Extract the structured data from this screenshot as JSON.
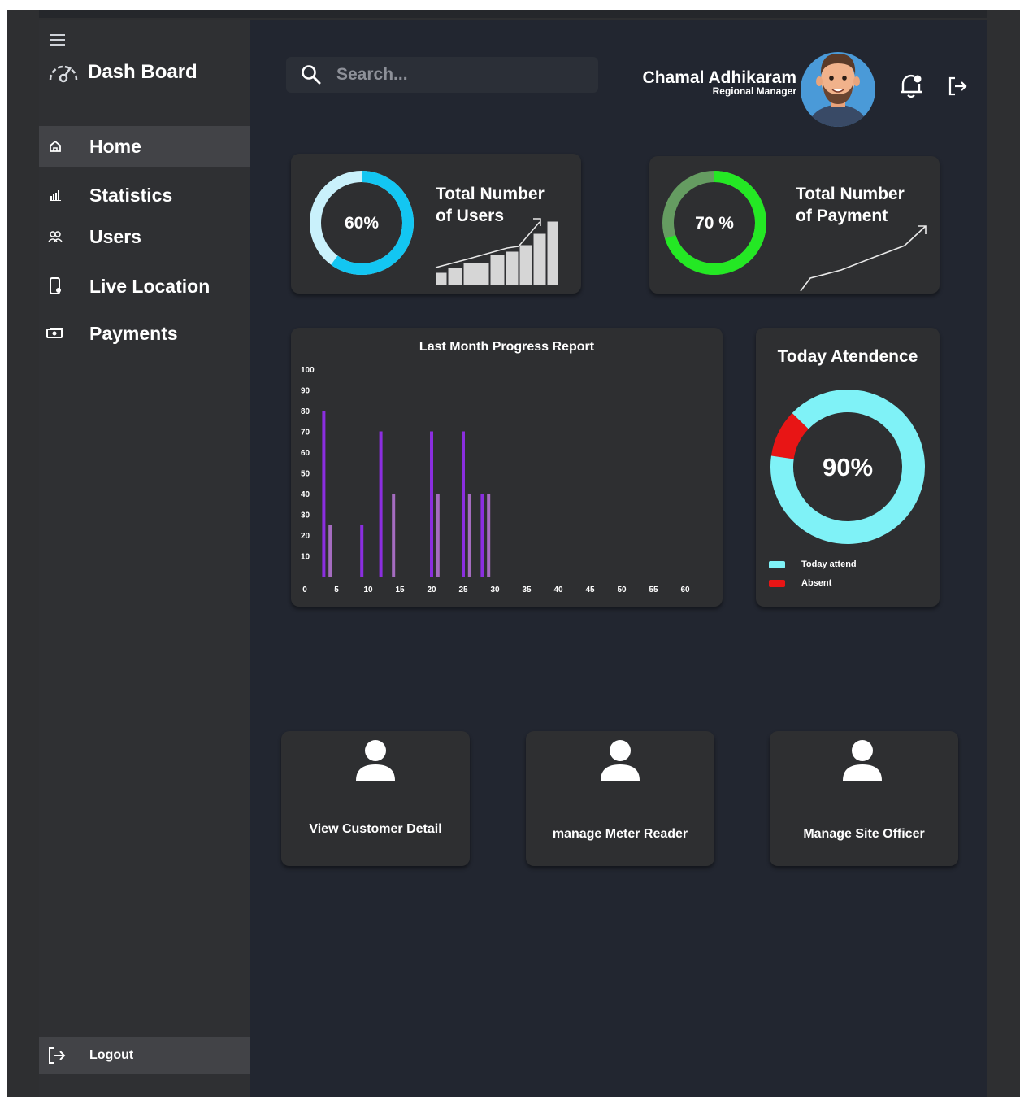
{
  "colors": {
    "main_bg": "#222630",
    "sidebar_bg": "#2f3033",
    "card_bg": "#2e2f31",
    "users_ring": "#13c6f2",
    "payment_ring": "#24e824",
    "bar_primary": "#8b2ee0",
    "bar_secondary": "#a56cc0",
    "attend": "#7ff2f7",
    "absent": "#e81515"
  },
  "sidebar": {
    "menu_icon": "hamburger-icon",
    "brand_icon": "speedometer-icon",
    "brand_title": "Dash Board",
    "items": [
      {
        "label": "Home",
        "icon": "home-icon"
      },
      {
        "label": "Statistics",
        "icon": "bar-chart-icon"
      },
      {
        "label": "Users",
        "icon": "users-icon"
      },
      {
        "label": "Live Location",
        "icon": "location-phone-icon"
      },
      {
        "label": "Payments",
        "icon": "payments-icon"
      }
    ],
    "logout": {
      "label": "Logout",
      "icon": "logout-icon"
    }
  },
  "header": {
    "search_placeholder": "Search...",
    "user_name": "Chamal Adhikaram",
    "user_role": "Regional Manager",
    "avatar_icon": "avatar",
    "notification_icon": "bell-icon",
    "exit_icon": "exit-icon"
  },
  "stats": {
    "users": {
      "percent": 60,
      "label": "60%",
      "title_line1": "Total Number",
      "title_line2": "of Users"
    },
    "payment": {
      "percent": 70,
      "label": "70 %",
      "title_line1": "Total Number",
      "title_line2": "of Payment"
    }
  },
  "chart_data": {
    "type": "bar",
    "title": "Last Month Progress Report",
    "xlabel": "",
    "ylabel": "",
    "x_ticks": [
      0,
      5,
      10,
      15,
      20,
      25,
      30,
      35,
      40,
      45,
      50,
      55,
      60
    ],
    "y_ticks": [
      10,
      20,
      30,
      40,
      50,
      60,
      70,
      80,
      90,
      100
    ],
    "xlim": [
      0,
      60
    ],
    "ylim": [
      0,
      100
    ],
    "grid": false,
    "series": [
      {
        "x": [
          3,
          9,
          12,
          20,
          25,
          28
        ],
        "values": [
          80,
          25,
          70,
          70,
          70,
          40
        ]
      },
      {
        "x": [
          4,
          14,
          21,
          26,
          29
        ],
        "values": [
          25,
          40,
          40,
          40,
          40
        ]
      }
    ]
  },
  "attendance": {
    "title": "Today Atendence",
    "percent": 90,
    "label": "90%",
    "legend": [
      {
        "label": "Today attend"
      },
      {
        "label": "Absent"
      }
    ]
  },
  "actions": [
    {
      "label": "View Customer Detail",
      "icon": "person-icon"
    },
    {
      "label": "manage Meter Reader",
      "icon": "person-icon"
    },
    {
      "label": "Manage Site Officer",
      "icon": "person-icon"
    }
  ]
}
